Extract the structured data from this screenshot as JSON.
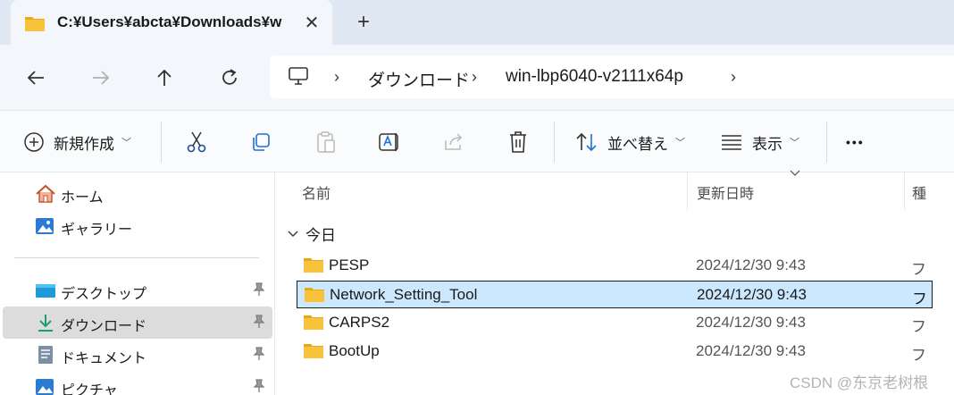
{
  "tab": {
    "title": "C:¥Users¥abcta¥Downloads¥w",
    "close_glyph": "✕",
    "new_glyph": "+"
  },
  "nav": {
    "back": "←",
    "forward": "→",
    "up": "↑",
    "refresh": "↻"
  },
  "address": {
    "chevron": "›",
    "crumbs": [
      "ダウンロード",
      "win-lbp6040-v2111x64p"
    ]
  },
  "commands": {
    "new_label": "新規作成",
    "sort_label": "並べ替え",
    "view_label": "表示",
    "more_glyph": "•••",
    "dropdown_glyph": "﹀"
  },
  "sidebar": {
    "items": [
      {
        "label": "ホーム",
        "icon": "home-icon"
      },
      {
        "label": "ギャラリー",
        "icon": "gallery-icon"
      },
      {
        "label": "デスクトップ",
        "icon": "desktop-icon",
        "pinned": true
      },
      {
        "label": "ダウンロード",
        "icon": "download-icon",
        "pinned": true,
        "selected": true
      },
      {
        "label": "ドキュメント",
        "icon": "documents-icon",
        "pinned": true
      },
      {
        "label": "ピクチャ",
        "icon": "pictures-icon",
        "pinned": true
      }
    ],
    "pin_glyph": "📌"
  },
  "columns": {
    "name": "名前",
    "modified": "更新日時",
    "type": "種"
  },
  "group": {
    "label": "今日",
    "chevron": "∨"
  },
  "files": [
    {
      "name": "PESP",
      "modified": "2024/12/30 9:43",
      "type": "フ"
    },
    {
      "name": "Network_Setting_Tool",
      "modified": "2024/12/30 9:43",
      "type": "フ",
      "selected": true
    },
    {
      "name": "CARPS2",
      "modified": "2024/12/30 9:43",
      "type": "フ"
    },
    {
      "name": "BootUp",
      "modified": "2024/12/30 9:43",
      "type": "フ"
    }
  ],
  "watermark": "CSDN @东京老树根",
  "colors": {
    "accent": "#0067c0",
    "folder": "#f8c33a",
    "selection": "#cce8ff"
  }
}
